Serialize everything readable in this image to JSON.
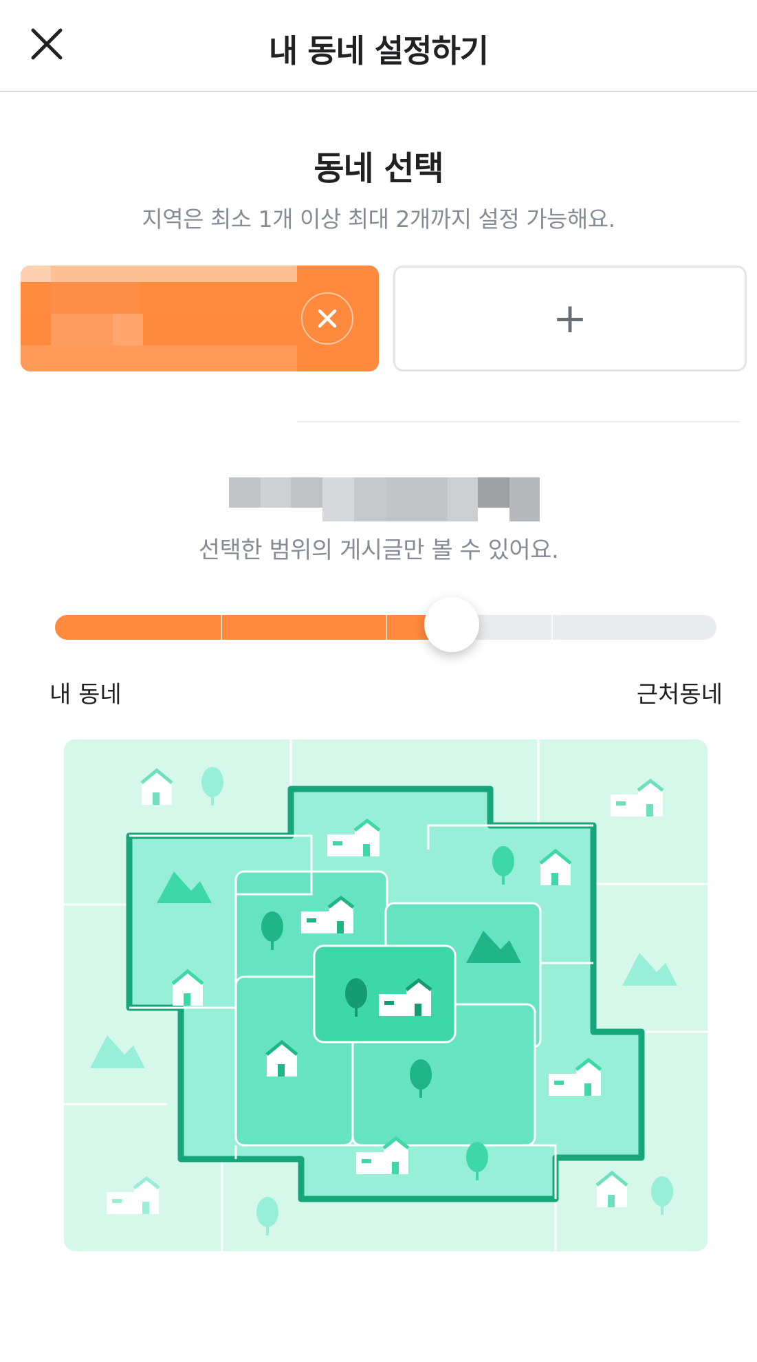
{
  "header": {
    "title": "내 동네 설정하기",
    "close_icon": "close-icon"
  },
  "section": {
    "title": "동네 선택",
    "subtitle": "지역은 최소 1개 이상 최대 2개까지 설정 가능해요."
  },
  "chips": {
    "selected_label": "",
    "remove_icon": "close-circle-icon",
    "add_icon": "plus-icon",
    "add_symbol": "+"
  },
  "range": {
    "label": "",
    "subtitle": "선택한 범위의 게시글만 볼 수 있어요."
  },
  "slider": {
    "left_label": "내 동네",
    "right_label": "근처동네",
    "steps": 4,
    "value": 2
  },
  "colors": {
    "accent": "#ff8a3d",
    "map_outer": "#d6f8ea",
    "map_mid": "#96efd6",
    "map_inner": "#66e3c0",
    "map_center": "#3ed8a8",
    "map_border": "#17a67a"
  }
}
